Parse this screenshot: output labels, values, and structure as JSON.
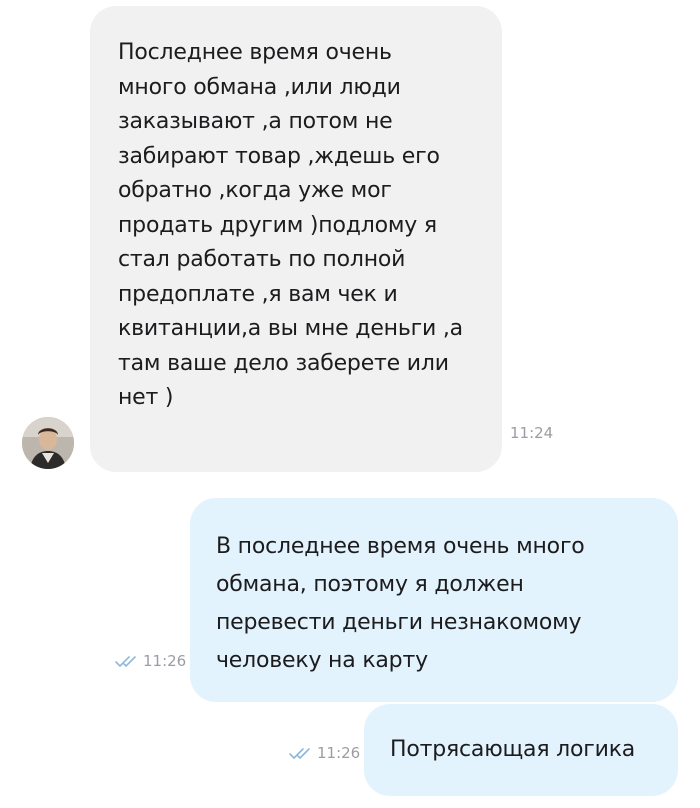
{
  "messages": [
    {
      "direction": "incoming",
      "text": "Последнее время очень\nмного обмана ,или люди\nзаказывают ,а потом не\nзабирают товар ,ждешь его\nобратно ,когда уже мог\nпродать другим )подлому я\nстал работать по полной\nпредоплате ,я вам чек и\nквитанции,а вы мне деньги ,а\nтам ваше дело заберете или\nнет )",
      "time": "11:24",
      "avatar": "user-avatar-photo"
    },
    {
      "direction": "outgoing",
      "text": "В последнее время очень много\nобмана, поэтому я должен\nперевести деньги незнакомому\nчеловеку на карту",
      "time": "11:26",
      "status_icon": "double-check-icon"
    },
    {
      "direction": "outgoing",
      "text": "Потрясающая логика",
      "time": "11:26",
      "status_icon": "double-check-icon"
    }
  ],
  "colors": {
    "incoming_bubble": "#f1f1f2",
    "outgoing_bubble": "#e3f3fd",
    "timestamp": "#9a9da3",
    "read_check": "#8fb8dc",
    "text": "#1c1c1e"
  }
}
